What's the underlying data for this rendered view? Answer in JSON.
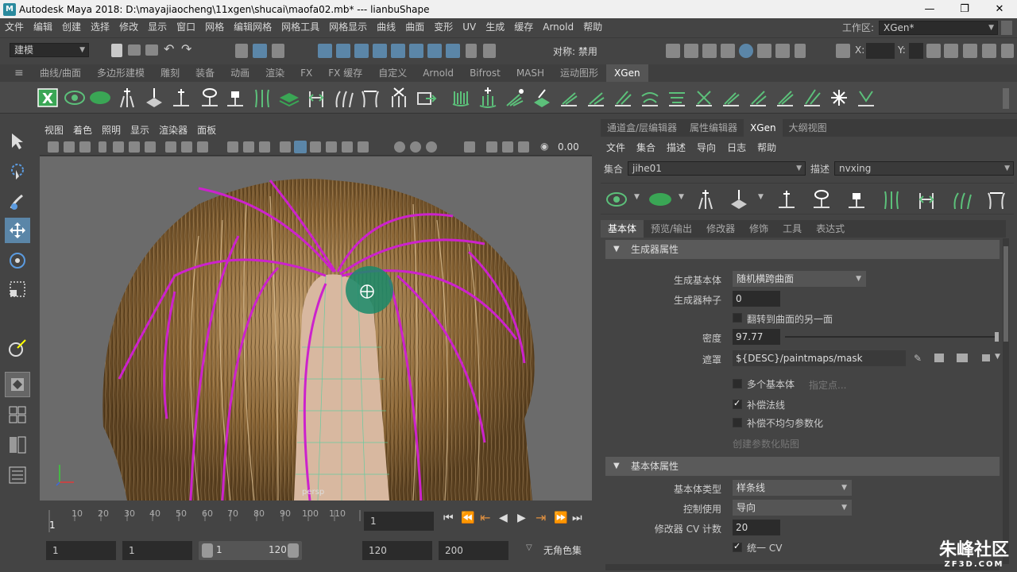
{
  "title": {
    "text": "Autodesk Maya 2018: D:\\mayajiaocheng\\11xgen\\shucai\\maofa02.mb*   ---   lianbuShape",
    "minimize": "—",
    "restore": "❐",
    "close": "✕"
  },
  "menubar": {
    "items": [
      "文件",
      "编辑",
      "创建",
      "选择",
      "修改",
      "显示",
      "窗口",
      "网格",
      "编辑网格",
      "网格工具",
      "网格显示",
      "曲线",
      "曲面",
      "变形",
      "UV",
      "生成",
      "缓存",
      "Arnold",
      "帮助"
    ],
    "workspace_label": "工作区:",
    "workspace_value": "XGen*"
  },
  "statusline": {
    "mode": "建模",
    "symmetry": "对称: 禁用",
    "x_label": "X:",
    "y_label": "Y:"
  },
  "shelf": {
    "tabs": [
      "曲线/曲面",
      "多边形建模",
      "雕刻",
      "装备",
      "动画",
      "渲染",
      "FX",
      "FX 缓存",
      "自定义",
      "Arnold",
      "Bifrost",
      "MASH",
      "运动图形",
      "XGen"
    ],
    "active_tab": "XGen"
  },
  "viewport": {
    "menu": [
      "视图",
      "着色",
      "照明",
      "显示",
      "渲染器",
      "面板"
    ],
    "value": "0.00",
    "hud": "persp"
  },
  "timeline": {
    "ticks": [
      "1",
      "10",
      "20",
      "30",
      "40",
      "50",
      "60",
      "70",
      "80",
      "90",
      "100",
      "110"
    ],
    "current_frame": "1",
    "range_start": "1",
    "range_anim_start": "1",
    "slider_start": "1",
    "slider_end": "120",
    "range_end": "120",
    "anim_end": "200",
    "character": "无角色集"
  },
  "panel": {
    "tabs": [
      "通道盒/层编辑器",
      "属性编辑器",
      "XGen",
      "大纲视图"
    ],
    "active_tab": "XGen",
    "menu": [
      "文件",
      "集合",
      "描述",
      "导向",
      "日志",
      "帮助"
    ],
    "collection_label": "集合",
    "collection_value": "jihe01",
    "description_label": "描述",
    "description_value": "nvxing",
    "subtabs": [
      "基本体",
      "预览/输出",
      "修改器",
      "修饰",
      "工具",
      "表达式"
    ],
    "active_subtab": "基本体",
    "section1": "生成器属性",
    "gen_primitive_label": "生成基本体",
    "gen_primitive_value": "随机横跨曲面",
    "gen_seed_label": "生成器种子",
    "gen_seed_value": "0",
    "flip_label": "翻转到曲面的另一面",
    "density_label": "密度",
    "density_value": "97.77",
    "mask_label": "遮罩",
    "mask_value": "${DESC}/paintmaps/mask",
    "multi_label": "多个基本体",
    "specify_points": "指定点...",
    "comp_normals_label": "补偿法线",
    "comp_uneven_label": "补偿不均匀参数化",
    "create_map": "创建参数化贴图",
    "section2": "基本体属性",
    "prim_type_label": "基本体类型",
    "prim_type_value": "样条线",
    "control_label": "控制使用",
    "control_value": "导向",
    "modcv_label": "修改器 CV 计数",
    "modcv_value": "20",
    "unify_cv_label": "统一 CV"
  },
  "watermark": {
    "line1": "朱峰社区",
    "line2": "ZF3D.COM"
  },
  "colors": {
    "accent": "#5b86a8",
    "guide": "#cc22cc",
    "hair": "#8a6535",
    "scalp": "#d8b8a0",
    "active_tab": "#555555"
  }
}
